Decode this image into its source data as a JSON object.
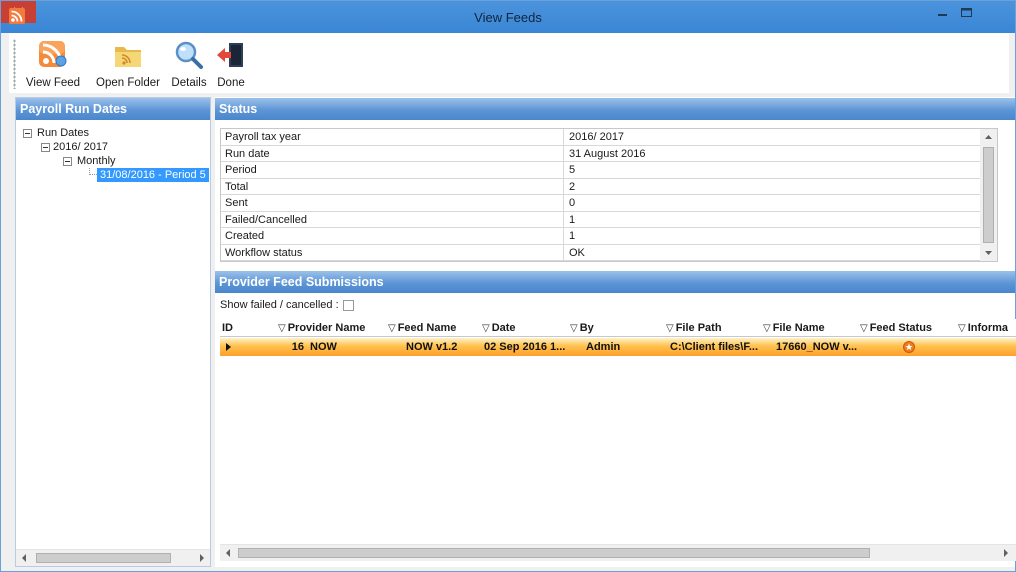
{
  "window": {
    "title": "View Feeds"
  },
  "toolbar": {
    "buttons": [
      {
        "label": "View Feed",
        "icon": "rss-feed-icon"
      },
      {
        "label": "Open Folder",
        "icon": "folder-icon"
      },
      {
        "label": "Details",
        "icon": "magnifier-icon"
      },
      {
        "label": "Done",
        "icon": "exit-door-icon"
      }
    ]
  },
  "left_panel": {
    "title": "Payroll Run Dates",
    "tree": {
      "root": "Run Dates",
      "year": "2016/ 2017",
      "frequency": "Monthly",
      "selected": "31/08/2016 - Period 5"
    }
  },
  "status": {
    "title": "Status",
    "rows": [
      {
        "key": "Payroll tax year",
        "value": "2016/ 2017"
      },
      {
        "key": "Run date",
        "value": "31 August 2016"
      },
      {
        "key": "Period",
        "value": "5"
      },
      {
        "key": "Total",
        "value": "2"
      },
      {
        "key": "Sent",
        "value": "0"
      },
      {
        "key": "Failed/Cancelled",
        "value": "1"
      },
      {
        "key": "Created",
        "value": "1"
      },
      {
        "key": "Workflow status",
        "value": "OK"
      }
    ]
  },
  "submissions": {
    "title": "Provider Feed Submissions",
    "show_failed_label": "Show failed / cancelled :",
    "columns": [
      "ID",
      "Provider Name",
      "Feed Name",
      "Date",
      "By",
      "File Path",
      "File Name",
      "Feed Status",
      "Informa"
    ],
    "rows": [
      {
        "id": "16",
        "provider": "NOW",
        "feed": "NOW v1.2",
        "date": "02 Sep 2016 1...",
        "by": "Admin",
        "path": "C:\\Client files\\F...",
        "file": "17660_NOW v...",
        "status_icon": "status-star-icon"
      }
    ]
  },
  "colors": {
    "title_bar": "#3e8ad8",
    "header_blue": "#5d95d6",
    "selected_row": "#ffb447",
    "tree_selection": "#3399ff",
    "close_button": "#c84033"
  }
}
